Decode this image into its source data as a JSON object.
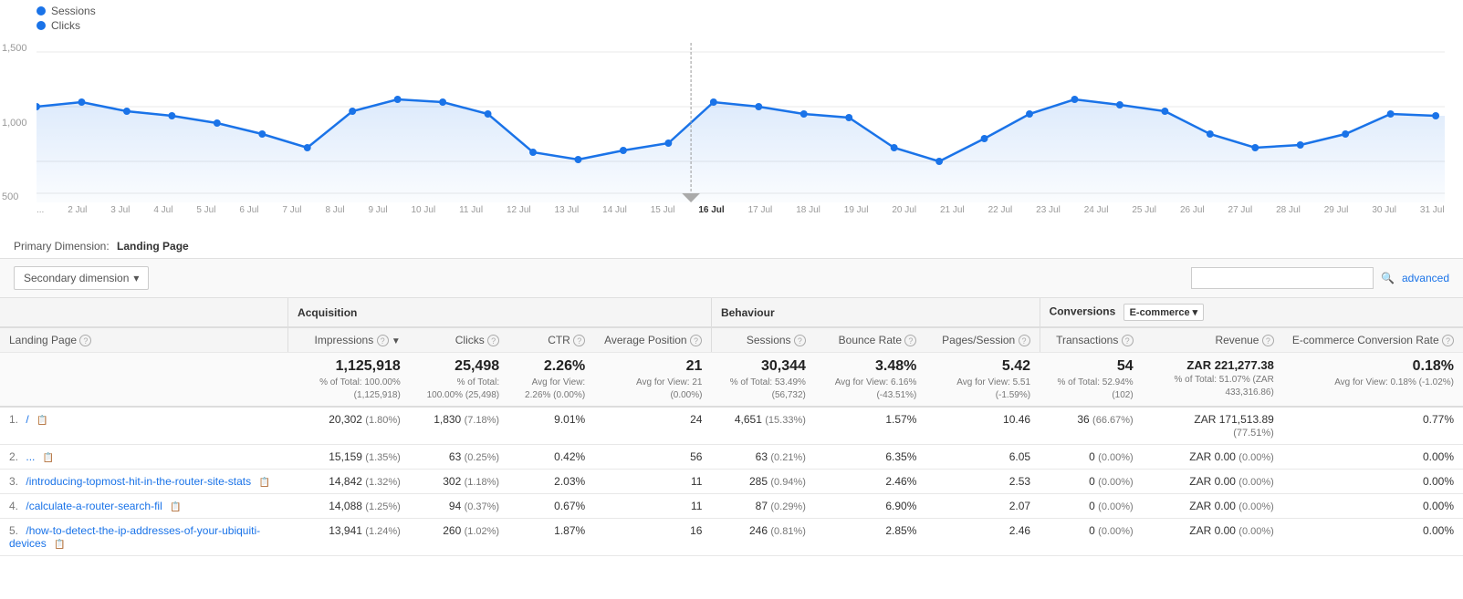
{
  "legend": {
    "sessions_label": "Sessions",
    "clicks_label": "Clicks"
  },
  "yaxis": [
    "1,500",
    "1,000",
    "500"
  ],
  "xaxis": [
    "...",
    "2 Jul",
    "3 Jul",
    "4 Jul",
    "5 Jul",
    "6 Jul",
    "7 Jul",
    "8 Jul",
    "9 Jul",
    "10 Jul",
    "11 Jul",
    "12 Jul",
    "13 Jul",
    "14 Jul",
    "15 Jul",
    "16 Jul",
    "17 Jul",
    "18 Jul",
    "19 Jul",
    "20 Jul",
    "21 Jul",
    "22 Jul",
    "23 Jul",
    "24 Jul",
    "25 Jul",
    "26 Jul",
    "27 Jul",
    "28 Jul",
    "29 Jul",
    "30 Jul",
    "31 Jul"
  ],
  "controls": {
    "secondary_dim_label": "Secondary dimension",
    "search_placeholder": "",
    "advanced_label": "advanced"
  },
  "primary_dim": {
    "label": "Primary Dimension:",
    "value": "Landing Page"
  },
  "table": {
    "section_headers": {
      "acquisition": "Acquisition",
      "behaviour": "Behaviour",
      "conversions": "Conversions",
      "ecommerce": "E-commerce"
    },
    "columns": {
      "landing_page": "Landing Page",
      "impressions": "Impressions",
      "clicks": "Clicks",
      "ctr": "CTR",
      "avg_position": "Average Position",
      "sessions": "Sessions",
      "bounce_rate": "Bounce Rate",
      "pages_session": "Pages/Session",
      "transactions": "Transactions",
      "revenue": "Revenue",
      "ecomm_conversion": "E-commerce Conversion Rate"
    },
    "totals": {
      "impressions": "1,125,918",
      "impressions_sub": "% of Total: 100.00% (1,125,918)",
      "clicks": "25,498",
      "clicks_sub": "% of Total: 100.00% (25,498)",
      "ctr": "2.26%",
      "ctr_sub": "Avg for View: 2.26% (0.00%)",
      "avg_position": "21",
      "avg_position_sub": "Avg for View: 21 (0.00%)",
      "sessions": "30,344",
      "sessions_sub": "% of Total: 53.49% (56,732)",
      "bounce_rate": "3.48%",
      "bounce_rate_sub": "Avg for View: 6.16% (-43.51%)",
      "pages_session": "5.42",
      "pages_session_sub": "Avg for View: 5.51 (-1.59%)",
      "transactions": "54",
      "transactions_sub": "% of Total: 52.94% (102)",
      "revenue": "ZAR 221,277.38",
      "revenue_sub": "% of Total: 51.07% (ZAR 433,316.86)",
      "ecomm_rate": "0.18%",
      "ecomm_rate_sub": "Avg for View: 0.18% (-1.02%)"
    },
    "rows": [
      {
        "num": "1.",
        "page": "/",
        "impressions": "20,302",
        "impressions_pct": "(1.80%)",
        "clicks": "1,830",
        "clicks_pct": "(7.18%)",
        "ctr": "9.01%",
        "avg_position": "24",
        "sessions": "4,651",
        "sessions_pct": "(15.33%)",
        "bounce_rate": "1.57%",
        "pages_session": "10.46",
        "transactions": "36",
        "transactions_pct": "(66.67%)",
        "revenue": "ZAR 171,513.89",
        "revenue_pct": "(77.51%)",
        "ecomm_rate": "0.77%"
      },
      {
        "num": "2.",
        "page": "...",
        "impressions": "15,159",
        "impressions_pct": "(1.35%)",
        "clicks": "63",
        "clicks_pct": "(0.25%)",
        "ctr": "0.42%",
        "avg_position": "56",
        "sessions": "63",
        "sessions_pct": "(0.21%)",
        "bounce_rate": "6.35%",
        "pages_session": "6.05",
        "transactions": "0",
        "transactions_pct": "(0.00%)",
        "revenue": "ZAR 0.00",
        "revenue_pct": "(0.00%)",
        "ecomm_rate": "0.00%"
      },
      {
        "num": "3.",
        "page": "/introducing-topmost-hit-in-the-router-site-stats",
        "impressions": "14,842",
        "impressions_pct": "(1.32%)",
        "clicks": "302",
        "clicks_pct": "(1.18%)",
        "ctr": "2.03%",
        "avg_position": "11",
        "sessions": "285",
        "sessions_pct": "(0.94%)",
        "bounce_rate": "2.46%",
        "pages_session": "2.53",
        "transactions": "0",
        "transactions_pct": "(0.00%)",
        "revenue": "ZAR 0.00",
        "revenue_pct": "(0.00%)",
        "ecomm_rate": "0.00%"
      },
      {
        "num": "4.",
        "page": "/calculate-a-router-search-fil",
        "impressions": "14,088",
        "impressions_pct": "(1.25%)",
        "clicks": "94",
        "clicks_pct": "(0.37%)",
        "ctr": "0.67%",
        "avg_position": "11",
        "sessions": "87",
        "sessions_pct": "(0.29%)",
        "bounce_rate": "6.90%",
        "pages_session": "2.07",
        "transactions": "0",
        "transactions_pct": "(0.00%)",
        "revenue": "ZAR 0.00",
        "revenue_pct": "(0.00%)",
        "ecomm_rate": "0.00%"
      },
      {
        "num": "5.",
        "page": "/how-to-detect-the-ip-addresses-of-your-ubiquiti-devices",
        "impressions": "13,941",
        "impressions_pct": "(1.24%)",
        "clicks": "260",
        "clicks_pct": "(1.02%)",
        "ctr": "1.87%",
        "avg_position": "16",
        "sessions": "246",
        "sessions_pct": "(0.81%)",
        "bounce_rate": "2.85%",
        "pages_session": "2.46",
        "transactions": "0",
        "transactions_pct": "(0.00%)",
        "revenue": "ZAR 0.00",
        "revenue_pct": "(0.00%)",
        "ecomm_rate": "0.00%"
      }
    ]
  }
}
